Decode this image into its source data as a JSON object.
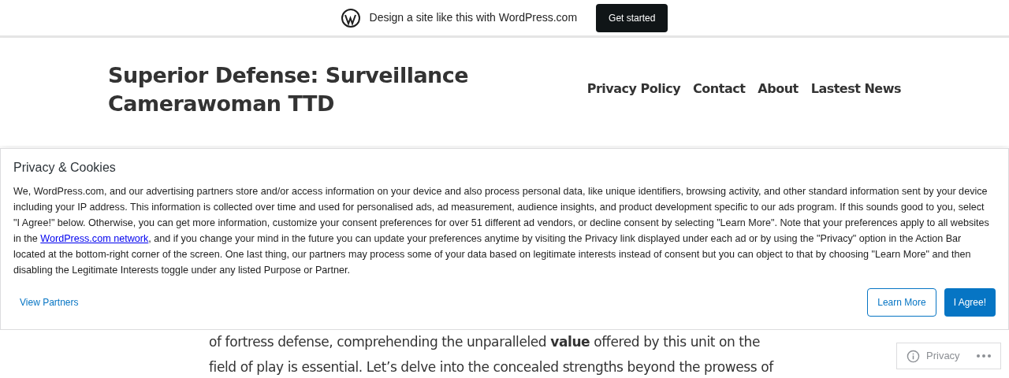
{
  "promo_bar": {
    "text": "Design a site like this with WordPress.com",
    "button": "Get started"
  },
  "site": {
    "title_lines": [
      "Superior Defense: Surveillance",
      "Camerawoman TTD"
    ]
  },
  "nav": [
    "Privacy Policy",
    "Contact",
    "About",
    "Lastest News"
  ],
  "article": {
    "lines": [
      "of fortress defense, comprehending the unparalleled **value** offered by this unit on the",
      "field of play is essential. Let’s delve into the concealed strengths beyond the prowess of"
    ]
  },
  "consent": {
    "title": "Privacy & Cookies",
    "text_before": "We, WordPress.com, and our advertising partners store and/or access information on your device and also process personal data, like unique identifiers, browsing activity, and other standard information sent by your device including your IP address. This information is collected over time and used for personalised ads, ad measurement, audience insights, and product development specific to our ads program. If this sounds good to you, select \"I Agree!\" below. Otherwise, you can get more information, customize your consent preferences for over 51 different ad vendors, or decline consent by selecting \"Learn More\". Note that your preferences apply to all websites in the ",
    "link": "WordPress.com network",
    "text_after": ", and if you change your mind in the future you can update your preferences anytime by visiting the Privacy link displayed under each ad or by using the \"Privacy\" option in the Action Bar located at the bottom-right corner of the screen. One last thing, our partners may process some of your data based on legitimate interests instead of consent but you can object to that by choosing \"Learn More\" and then disabling the Legitimate Interests toggle under any listed Purpose or Partner.",
    "partners_link": "View Partners",
    "learn_more": "Learn More",
    "agree": "I Agree!"
  },
  "action_bar": {
    "label": "Privacy"
  }
}
